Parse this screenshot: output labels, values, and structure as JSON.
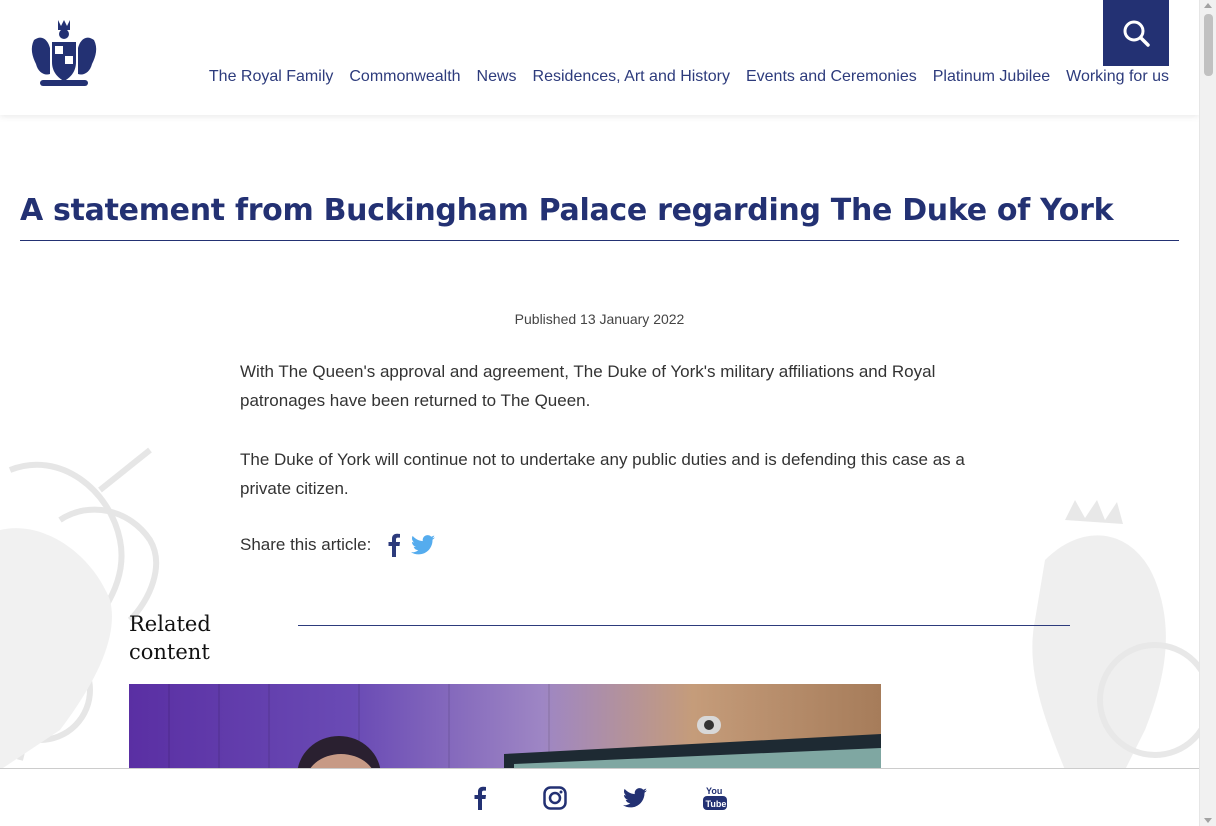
{
  "header": {
    "nav": [
      "The Royal Family",
      "Commonwealth",
      "News",
      "Residences, Art and History",
      "Events and Ceremonies",
      "Platinum Jubilee",
      "Working for us"
    ],
    "logo_icon": "royal-coat-of-arms",
    "search_icon": "search-icon",
    "search_bg_color": "#233173"
  },
  "article": {
    "title": "A statement from Buckingham Palace regarding The Duke of York",
    "published": "Published 13 January 2022",
    "paragraphs": [
      "With The Queen's approval and agreement, The Duke of York's military affiliations and Royal patronages have been returned to The Queen.",
      "The Duke of York will continue not to undertake any public duties and is defending this case as a private citizen."
    ],
    "share_label": "Share this article:",
    "share_icons": [
      "facebook-icon",
      "twitter-icon"
    ]
  },
  "related": {
    "heading": "Related content"
  },
  "footer": {
    "social_icons": [
      "facebook-icon",
      "instagram-icon",
      "twitter-icon",
      "youtube-icon"
    ],
    "youtube_top": "You",
    "youtube_bottom": "Tube"
  },
  "colors": {
    "brand_navy": "#233173",
    "link_blue": "#2d3b7c",
    "twitter_blue": "#55acee"
  }
}
